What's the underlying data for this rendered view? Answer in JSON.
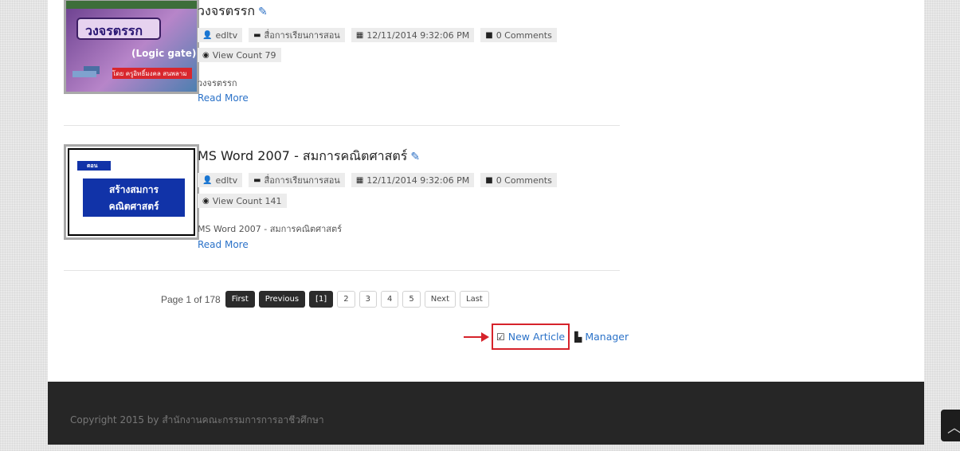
{
  "articles": [
    {
      "title": "วงจรตรรก",
      "thumb": {
        "title": "วงจรตรรก",
        "subtitle": "(Logic gate)",
        "credit": "โดย ครูอิทธิ์มงคล สนพลาม"
      },
      "author": "edltv",
      "category": "สื่อการเรียนการสอน",
      "date": "12/11/2014 9:32:06 PM",
      "comments": "0 Comments",
      "view_count": "View Count 79",
      "excerpt": "วงจรตรรก",
      "read_more": "Read More"
    },
    {
      "title": "MS Word 2007 - สมการคณิตศาสตร์",
      "thumb": {
        "badge": "ตอน",
        "line1": "สร้างสมการ",
        "line2": "คณิตศาสตร์"
      },
      "author": "edltv",
      "category": "สื่อการเรียนการสอน",
      "date": "12/11/2014 9:32:06 PM",
      "comments": "0 Comments",
      "view_count": "View Count 141",
      "excerpt": "MS Word 2007 - สมการคณิตศาสตร์",
      "read_more": "Read More"
    }
  ],
  "pagination": {
    "label": "Page 1 of 178",
    "first": "First",
    "previous": "Previous",
    "current": "[1]",
    "pages": [
      "2",
      "3",
      "4",
      "5"
    ],
    "next": "Next",
    "last": "Last"
  },
  "actions": {
    "new_article": "New Article",
    "manager": "Manager"
  },
  "footer": {
    "copyright": "Copyright 2015 by สำนักงานคณะกรรมการการอาชีวศึกษา"
  },
  "colors": {
    "link": "#2b72c8",
    "highlight": "#d6232b",
    "footer_bg": "#262626",
    "thumb_blue": "#1133a8"
  },
  "icons": {
    "author": "user-icon",
    "category": "folder-icon",
    "date": "calendar-icon",
    "comments": "comment-icon",
    "views": "eye-icon",
    "edit": "pencil-icon",
    "new_article": "edit-square-icon",
    "manager": "document-icon",
    "scroll_top": "chevron-up-icon"
  }
}
